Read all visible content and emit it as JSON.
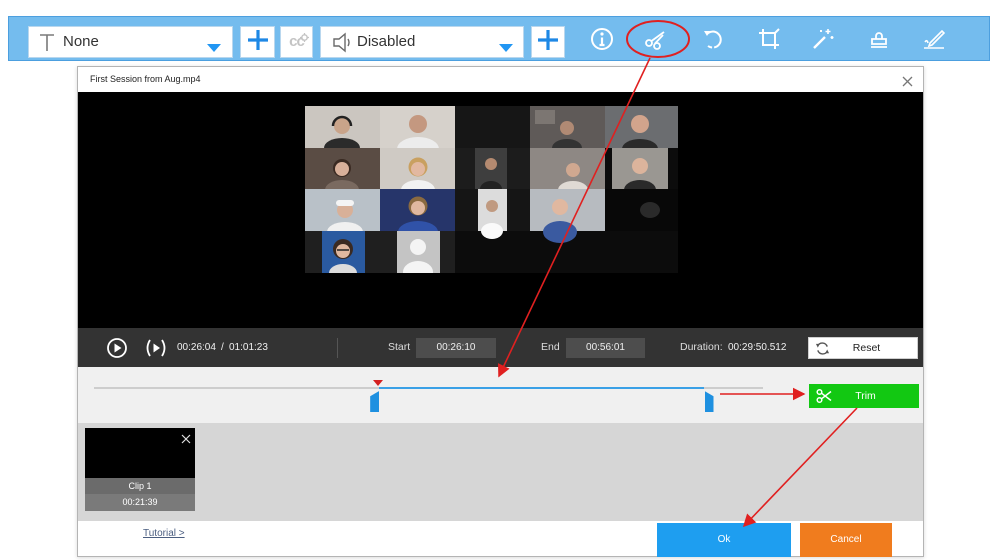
{
  "toolbar": {
    "text_dropdown": {
      "icon": "text-t-icon",
      "value": "None"
    },
    "add_text_icon": "plus-icon",
    "cc_label": "cc",
    "audio_dropdown": {
      "icon": "speaker-icon",
      "value": "Disabled"
    },
    "add_audio_icon": "plus-icon",
    "tools": [
      "info-icon",
      "scissors-icon",
      "rotate-icon",
      "crop-icon",
      "magic-wand-icon",
      "stamp-icon",
      "signature-icon"
    ]
  },
  "dialog": {
    "title": "First Session from Aug.mp4"
  },
  "player": {
    "current_time": "00:26:04",
    "separator": "/",
    "total_time": "01:01:23",
    "start_label": "Start",
    "start_value": "00:26:10",
    "end_label": "End",
    "end_value": "00:56:01",
    "duration_label": "Duration:",
    "duration_value": "00:29:50.512",
    "reset_label": "Reset"
  },
  "trim": {
    "label": "Trim"
  },
  "clips": [
    {
      "label": "Clip 1",
      "duration": "00:21:39"
    }
  ],
  "footer": {
    "tutorial": "Tutorial >",
    "ok": "Ok",
    "cancel": "Cancel"
  },
  "colors": {
    "toolbar_bg": "#74bcee",
    "selection_blue": "#3aa0e6",
    "trim_green": "#12c812",
    "ok_blue": "#1e9ef0",
    "cancel_orange": "#f07c1e",
    "annotation_red": "#e02020"
  }
}
